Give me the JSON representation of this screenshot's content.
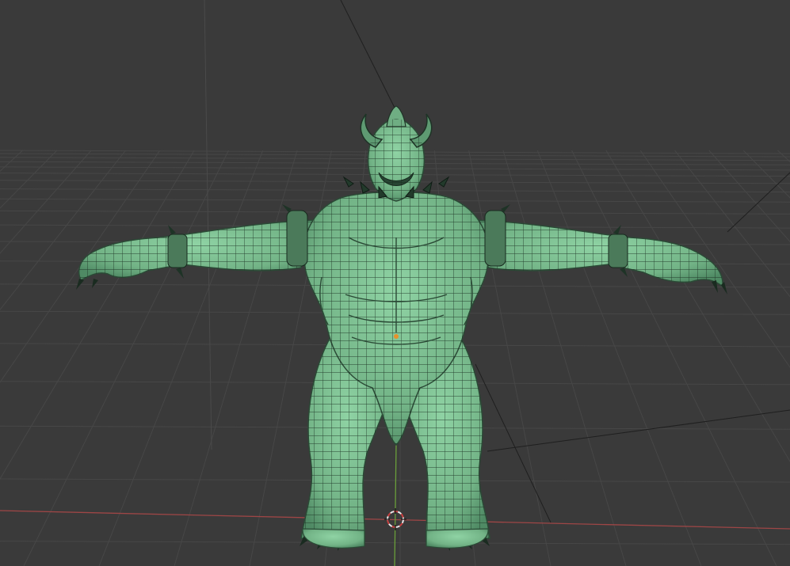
{
  "app": {
    "view": "3D Viewport",
    "shading_mode": "solid-wireframe",
    "background_color": "#3a3a3a",
    "grid_color": "#474747",
    "grid_dense_color": "#424242",
    "axis_x_color": "#9e4646",
    "axis_y_color": "#6a9f3a",
    "mesh_fill_color": "#7cbf92",
    "mesh_shade_color": "#3f7556",
    "mesh_wire_color": "#172a1e",
    "origin_dot_color": "#e8912b",
    "cursor_color_a": "#e8e8e8",
    "cursor_color_b": "#c84040"
  },
  "scene": {
    "object": "character-mesh",
    "icons": {
      "cursor": "3d-cursor-icon",
      "origin": "object-origin-icon"
    }
  }
}
